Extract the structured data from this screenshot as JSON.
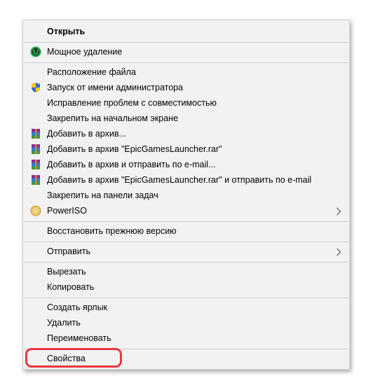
{
  "menu": {
    "open": "Открыть",
    "powerful_delete": "Мощное удаление",
    "file_location": "Расположение файла",
    "run_as_admin": "Запуск от имени администратора",
    "troubleshoot_compat": "Исправление проблем с совместимостью",
    "pin_start": "Закрепить на начальном экране",
    "add_archive": "Добавить в архив...",
    "add_archive_named": "Добавить в архив \"EpicGamesLauncher.rar\"",
    "add_archive_email": "Добавить в архив и отправить по e-mail...",
    "add_archive_named_email": "Добавить в архив \"EpicGamesLauncher.rar\" и отправить по e-mail",
    "pin_taskbar": "Закрепить на панели задач",
    "poweriso": "PowerISO",
    "restore_previous": "Восстановить прежнюю версию",
    "send_to": "Отправить",
    "cut": "Вырезать",
    "copy": "Копировать",
    "create_shortcut": "Создать ярлык",
    "delete": "Удалить",
    "rename": "Переименовать",
    "properties": "Свойства"
  },
  "icons": {
    "uninstaller": "uninstaller-icon",
    "shield": "uac-shield-icon",
    "winrar": "winrar-icon",
    "poweriso": "poweriso-disc-icon",
    "submenu": "chevron-right-icon"
  },
  "colors": {
    "menu_bg": "#f2f2f2",
    "highlight": "#e8363f"
  }
}
